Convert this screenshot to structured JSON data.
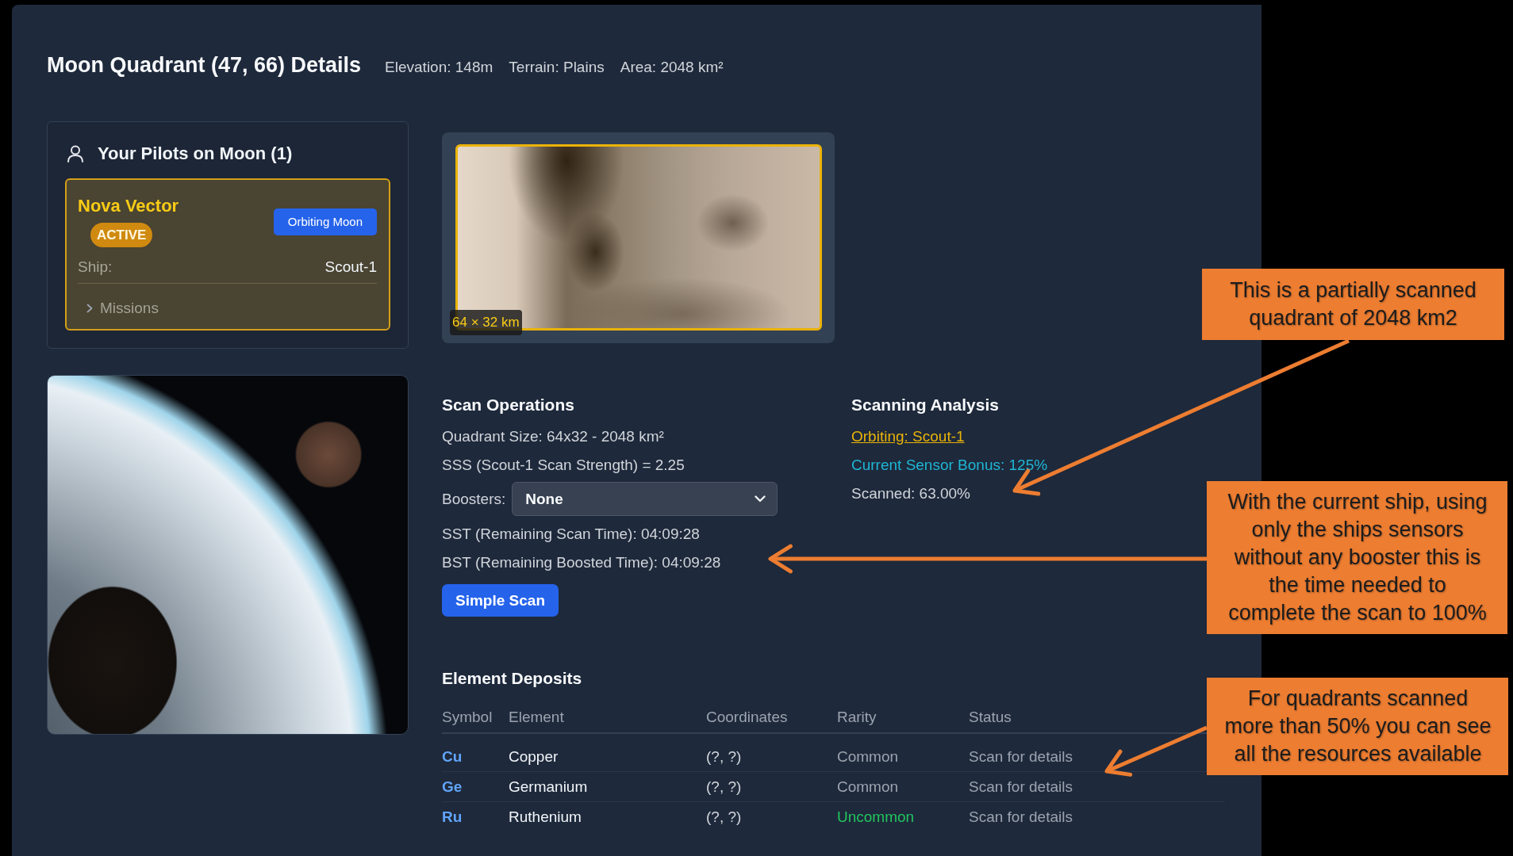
{
  "header": {
    "title": "Moon Quadrant (47, 66) Details",
    "meta": [
      "Elevation: 148m",
      "Terrain: Plains",
      "Area: 2048 km²"
    ]
  },
  "pilots_panel": {
    "title": "Your Pilots on Moon (1)",
    "pilots": [
      {
        "name": "Nova Vector",
        "status": "ACTIVE",
        "location": "Orbiting Moon",
        "ship_label": "Ship:",
        "ship": "Scout-1",
        "missions_label": "Missions",
        "missions_expanded": false
      }
    ]
  },
  "map": {
    "scale_label": "64 × 32 km"
  },
  "scan_operations": {
    "title": "Scan Operations",
    "lines_before": [
      "Quadrant Size: 64x32 - 2048 km²",
      "SSS (Scout-1 Scan Strength) = 2.25"
    ],
    "boosters": {
      "label": "Boosters:",
      "value": "None"
    },
    "lines_after": [
      "SST (Remaining Scan Time): 04:09:28",
      "BST (Remaining Boosted Time): 04:09:28"
    ],
    "button": "Simple Scan"
  },
  "scanning_analysis": {
    "title": "Scanning Analysis",
    "orbiting_link": "Orbiting: Scout-1",
    "sensor_bonus": "Current Sensor Bonus: 125%",
    "scanned": "Scanned: 63.00%"
  },
  "element_deposits": {
    "title": "Element Deposits",
    "columns": [
      "Symbol",
      "Element",
      "Coordinates",
      "Rarity",
      "Status"
    ],
    "rows": [
      {
        "symbol": "Cu",
        "element": "Copper",
        "coordinates": "(?, ?)",
        "rarity": "Common",
        "color": "#9ca3af",
        "status": "Scan for details"
      },
      {
        "symbol": "Ge",
        "element": "Germanium",
        "coordinates": "(?, ?)",
        "rarity": "Common",
        "color": "#9ca3af",
        "status": "Scan for details"
      },
      {
        "symbol": "Ru",
        "element": "Ruthenium",
        "coordinates": "(?, ?)",
        "rarity": "Uncommon",
        "color": "#22c55e",
        "status": "Scan for details"
      }
    ]
  },
  "annotations": [
    {
      "text": "This is a partially scanned quadrant of 2048 km2"
    },
    {
      "text": "With the current ship, using only the ships sensors without any booster this is the time needed to complete the scan to 100%"
    },
    {
      "text": "For quadrants scanned more than 50% you can see all the resources available"
    }
  ]
}
